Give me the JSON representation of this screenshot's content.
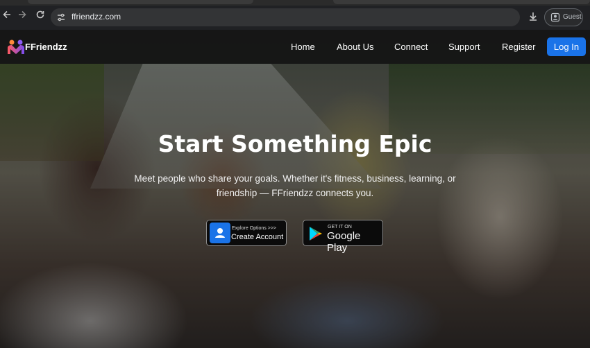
{
  "browser": {
    "url": "ffriendzz.com",
    "profile_label": "Guest",
    "icons": [
      "back-icon",
      "forward-icon",
      "reload-icon",
      "site-info-icon",
      "download-icon",
      "profile-icon"
    ]
  },
  "navbar": {
    "brand": "FFriendzz",
    "links": [
      "Home",
      "About Us",
      "Connect",
      "Support",
      "Register"
    ],
    "login_label": "Log In",
    "accent_color": "#1a73e8"
  },
  "hero": {
    "title": "Start Something Epic",
    "subtitle": "Meet people who share your goals. Whether it's fitness, business, learning, or friendship — FFriendzz connects you.",
    "create_button": {
      "small": "Explore Options >>>",
      "big": "Create Account"
    },
    "play_button": {
      "small": "GET IT ON",
      "big": "Google Play"
    }
  }
}
